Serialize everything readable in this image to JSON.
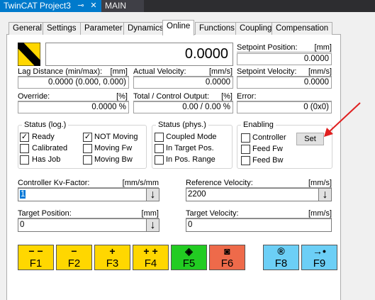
{
  "doc_tabs": {
    "active": "TwinCAT Project3",
    "pin_icon": "pin-icon",
    "close_icon": "close-icon",
    "other": "MAIN"
  },
  "tabs": [
    {
      "label": "General"
    },
    {
      "label": "Settings"
    },
    {
      "label": "Parameter"
    },
    {
      "label": "Dynamics"
    },
    {
      "label": "Online",
      "active": true
    },
    {
      "label": "Functions"
    },
    {
      "label": "Coupling"
    },
    {
      "label": "Compensation"
    }
  ],
  "display": {
    "value": "0.0000",
    "setpoint_position": {
      "label": "Setpoint Position:",
      "unit": "[mm]",
      "value": "0.0000"
    }
  },
  "row2": {
    "lag": {
      "label": "Lag Distance (min/max):",
      "unit": "[mm]",
      "value": "0.0000  (0.000, 0.000)"
    },
    "actual_velocity": {
      "label": "Actual Velocity:",
      "unit": "[mm/s]",
      "value": "0.0000"
    },
    "setpoint_velocity": {
      "label": "Setpoint Velocity:",
      "unit": "[mm/s]",
      "value": "0.0000"
    }
  },
  "row3": {
    "override": {
      "label": "Override:",
      "unit": "[%]",
      "value": "0.0000 %"
    },
    "total_output": {
      "label": "Total / Control Output:",
      "unit": "[%]",
      "value": "0.00 /  0.00 %"
    },
    "error": {
      "label": "Error:",
      "value": "0 (0x0)"
    }
  },
  "status_log": {
    "title": "Status (log.)",
    "items": [
      {
        "label": "Ready",
        "checked": "✓"
      },
      {
        "label": "NOT Moving",
        "checked": "✓"
      },
      {
        "label": "Calibrated",
        "checked": ""
      },
      {
        "label": "Moving Fw",
        "checked": ""
      },
      {
        "label": "Has Job",
        "checked": ""
      },
      {
        "label": "Moving Bw",
        "checked": ""
      }
    ]
  },
  "status_phys": {
    "title": "Status (phys.)",
    "items": [
      {
        "label": "Coupled Mode",
        "checked": ""
      },
      {
        "label": "In Target Pos.",
        "checked": ""
      },
      {
        "label": "In Pos. Range",
        "checked": ""
      }
    ]
  },
  "enabling": {
    "title": "Enabling",
    "items": [
      {
        "label": "Controller",
        "checked": ""
      },
      {
        "label": "Feed Fw",
        "checked": ""
      },
      {
        "label": "Feed Bw",
        "checked": ""
      }
    ],
    "set_button": "Set"
  },
  "controller_kv": {
    "label": "Controller Kv-Factor:",
    "unit": "[mm/s/mm",
    "value": "1"
  },
  "reference_velocity": {
    "label": "Reference Velocity:",
    "unit": "[mm/s]",
    "value": "2200"
  },
  "target_position": {
    "label": "Target Position:",
    "unit": "[mm]",
    "value": "0"
  },
  "target_velocity": {
    "label": "Target Velocity:",
    "unit": "[mm/s]",
    "value": "0"
  },
  "down_icon": "↓",
  "fkeys": [
    {
      "key": "F1",
      "icon": "− −",
      "color": "#ffd700"
    },
    {
      "key": "F2",
      "icon": "−",
      "color": "#ffd700"
    },
    {
      "key": "F3",
      "icon": "+",
      "color": "#ffd700"
    },
    {
      "key": "F4",
      "icon": "+ +",
      "color": "#ffd700"
    },
    {
      "key": "F5",
      "icon": "◈",
      "color": "#22cc22"
    },
    {
      "key": "F6",
      "icon": "◙",
      "color": "#ee6a4a"
    },
    {
      "key": "F8",
      "icon": "®",
      "color": "#6ccff6"
    },
    {
      "key": "F9",
      "icon": "→•",
      "color": "#6ccff6"
    }
  ],
  "colors": {
    "accent": "#007acc",
    "annotation_arrow": "#e02020"
  }
}
